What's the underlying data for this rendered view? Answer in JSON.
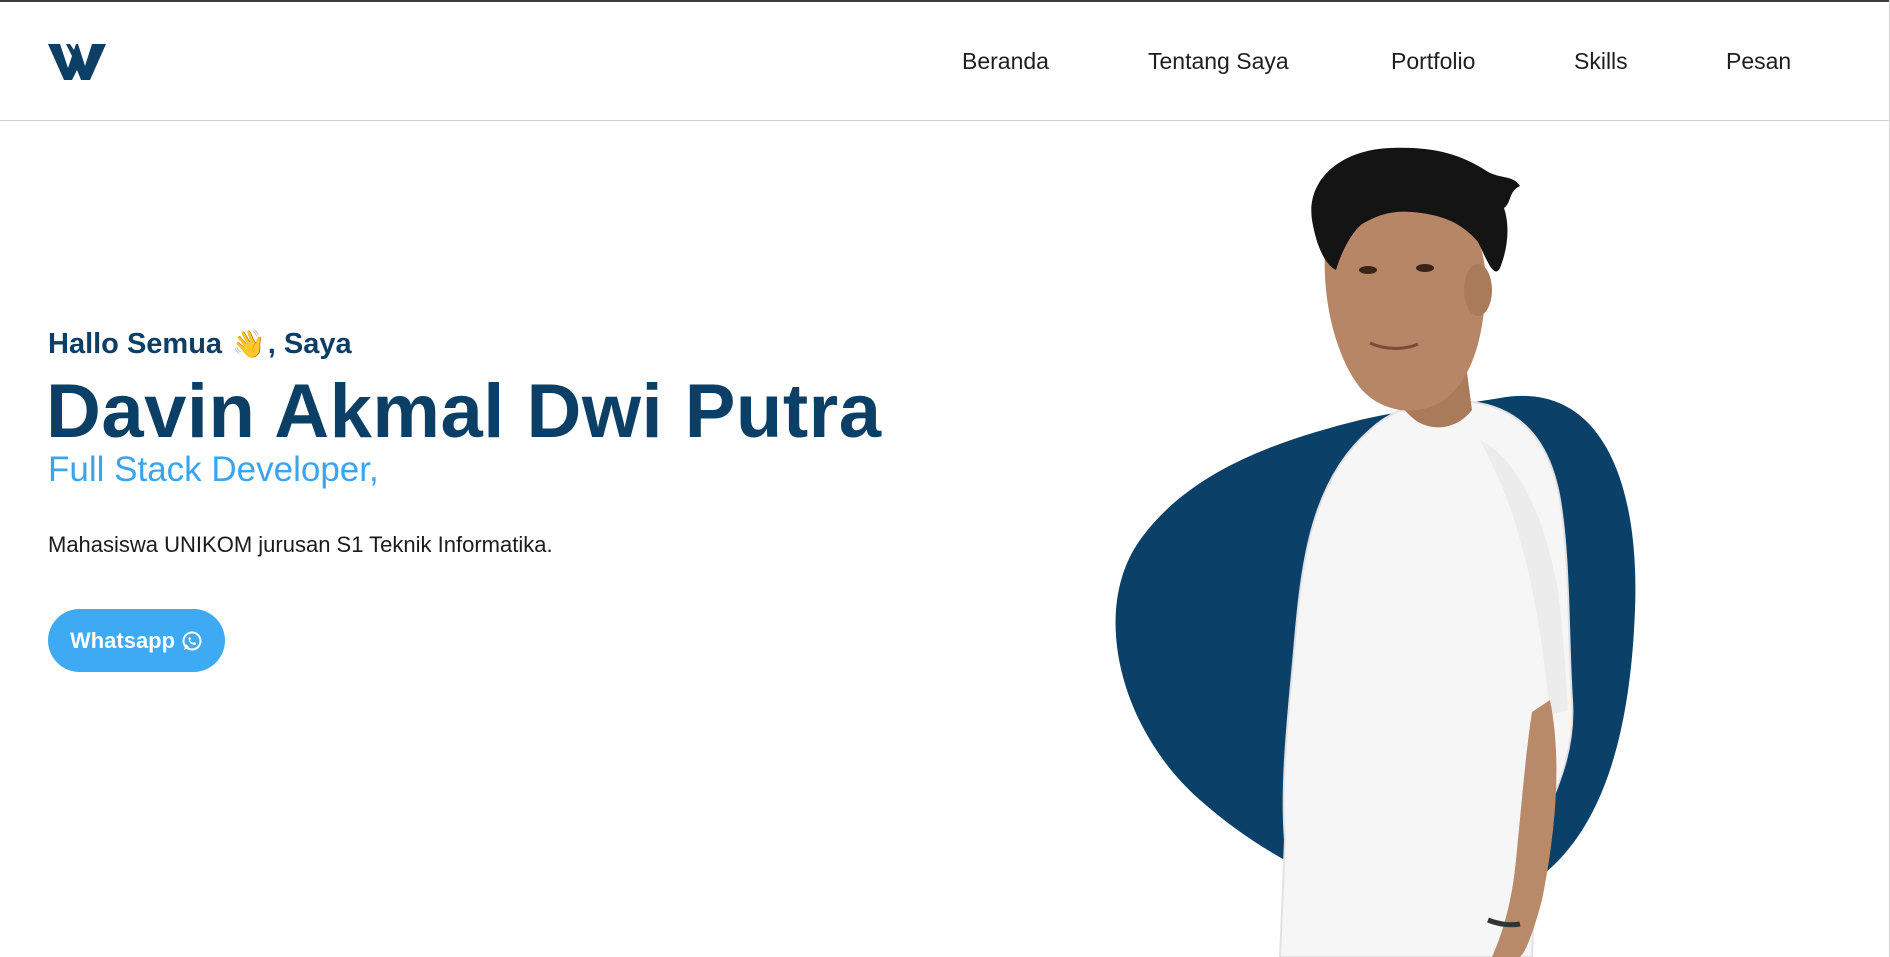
{
  "nav": {
    "logo_icon": "w-logo-icon",
    "items": [
      {
        "label": "Beranda"
      },
      {
        "label": "Tentang Saya"
      },
      {
        "label": "Portfolio"
      },
      {
        "label": "Skills"
      },
      {
        "label": "Pesan"
      }
    ]
  },
  "hero": {
    "greeting_before": "Hallo Semua",
    "wave_emoji": "👋",
    "greeting_after": ", Saya",
    "name": "Davin Akmal Dwi Putra",
    "role": "Full Stack Developer,",
    "description": "Mahasiswa UNIKOM jurusan S1 Teknik Informatika.",
    "button_label": "Whatsapp",
    "button_icon": "whatsapp-icon"
  },
  "colors": {
    "primary": "#0b3f66",
    "accent": "#3eaaf3",
    "text": "#1b1b1b"
  }
}
